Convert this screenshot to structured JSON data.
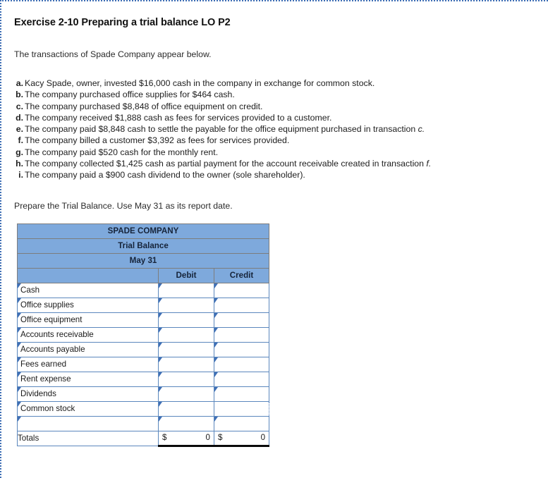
{
  "exercise": {
    "title": "Exercise 2-10 Preparing a trial balance LO P2",
    "intro": "The transactions of Spade Company appear below.",
    "prepare_instruction": "Prepare the Trial Balance. Use May 31 as its report date."
  },
  "transactions": [
    {
      "letter": "a.",
      "text": "Kacy Spade, owner, invested $16,000 cash in the company in exchange for common stock.",
      "ref": ""
    },
    {
      "letter": "b.",
      "text": "The company purchased office supplies for $464 cash.",
      "ref": ""
    },
    {
      "letter": "c.",
      "text": "The company purchased $8,848 of office equipment on credit.",
      "ref": ""
    },
    {
      "letter": "d.",
      "text": "The company received $1,888 cash as fees for services provided to a customer.",
      "ref": ""
    },
    {
      "letter": "e.",
      "text": "The company paid $8,848 cash to settle the payable for the office equipment purchased in transaction",
      "ref": "c."
    },
    {
      "letter": "f.",
      "text": "The company billed a customer $3,392 as fees for services provided.",
      "ref": ""
    },
    {
      "letter": "g.",
      "text": "The company paid $520 cash for the monthly rent.",
      "ref": ""
    },
    {
      "letter": "h.",
      "text": "The company collected $1,425 cash as partial payment for the account receivable created in transaction",
      "ref": "f."
    },
    {
      "letter": "i.",
      "text": "The company paid a $900 cash dividend to the owner (sole shareholder).",
      "ref": ""
    }
  ],
  "trial_balance": {
    "company_name": "SPADE COMPANY",
    "statement_name": "Trial Balance",
    "report_date": "May 31",
    "columns": {
      "account": "",
      "debit": "Debit",
      "credit": "Credit"
    },
    "rows": [
      {
        "account": "Cash",
        "debit": "",
        "credit": ""
      },
      {
        "account": "Office supplies",
        "debit": "",
        "credit": ""
      },
      {
        "account": "Office equipment",
        "debit": "",
        "credit": ""
      },
      {
        "account": "Accounts receivable",
        "debit": "",
        "credit": ""
      },
      {
        "account": "Accounts payable",
        "debit": "",
        "credit": ""
      },
      {
        "account": "Fees earned",
        "debit": "",
        "credit": ""
      },
      {
        "account": "Rent expense",
        "debit": "",
        "credit": ""
      },
      {
        "account": "Dividends",
        "debit": "",
        "credit": ""
      },
      {
        "account": "Common stock",
        "debit": "",
        "credit": ""
      },
      {
        "account": "",
        "debit": "",
        "credit": ""
      }
    ],
    "active_cell": {
      "row_index": 8,
      "column": "credit"
    },
    "totals": {
      "label": "Totals",
      "debit_currency": "$",
      "debit_value": "0",
      "credit_currency": "$",
      "credit_value": "0"
    }
  },
  "colors": {
    "header_blue": "#7ea9dc",
    "cell_border_blue": "#5b87bd",
    "dotted_rule_blue": "#3f6fb5"
  }
}
